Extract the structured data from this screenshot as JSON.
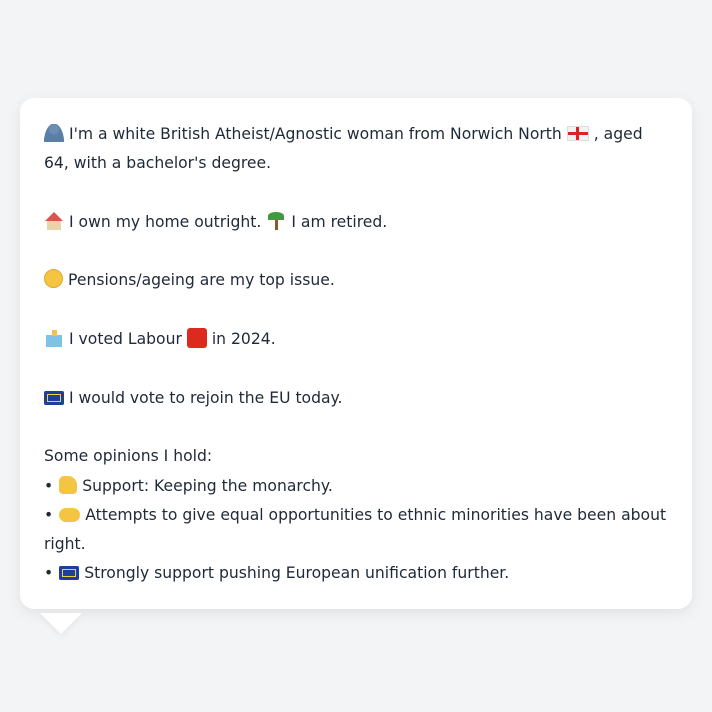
{
  "profile": {
    "identity": {
      "icon": "bust-silhouette-icon",
      "text": "I'm a white British Atheist/Agnostic woman from Norwich North",
      "flag_icon": "england-flag-icon",
      "text_after": ", aged 64, with a bachelor's degree."
    },
    "housing": {
      "icon": "house-icon",
      "text": "I own my home outright.",
      "work_icon": "palm-tree-icon",
      "work_text": "I am retired."
    },
    "issue": {
      "icon": "older-person-icon",
      "text": "Pensions/ageing are my top issue."
    },
    "vote": {
      "icon": "ballot-box-icon",
      "text_before": "I voted Labour",
      "party_icon": "red-square-icon",
      "party_color": "#dd2a1f",
      "text_after": "in 2024."
    },
    "eu": {
      "icon": "eu-flag-icon",
      "text": "I would vote to rejoin the EU today."
    }
  },
  "opinions": {
    "heading": "Some opinions I hold:",
    "bullet": "•",
    "items": [
      {
        "icon": "thumbs-up-icon",
        "text": "Support: Keeping the monarchy."
      },
      {
        "icon": "handshake-icon",
        "text": "Attempts to give equal opportunities to ethnic minorities have been about right."
      },
      {
        "icon": "eu-flag-icon",
        "text": "Strongly support pushing European unification further."
      }
    ]
  }
}
